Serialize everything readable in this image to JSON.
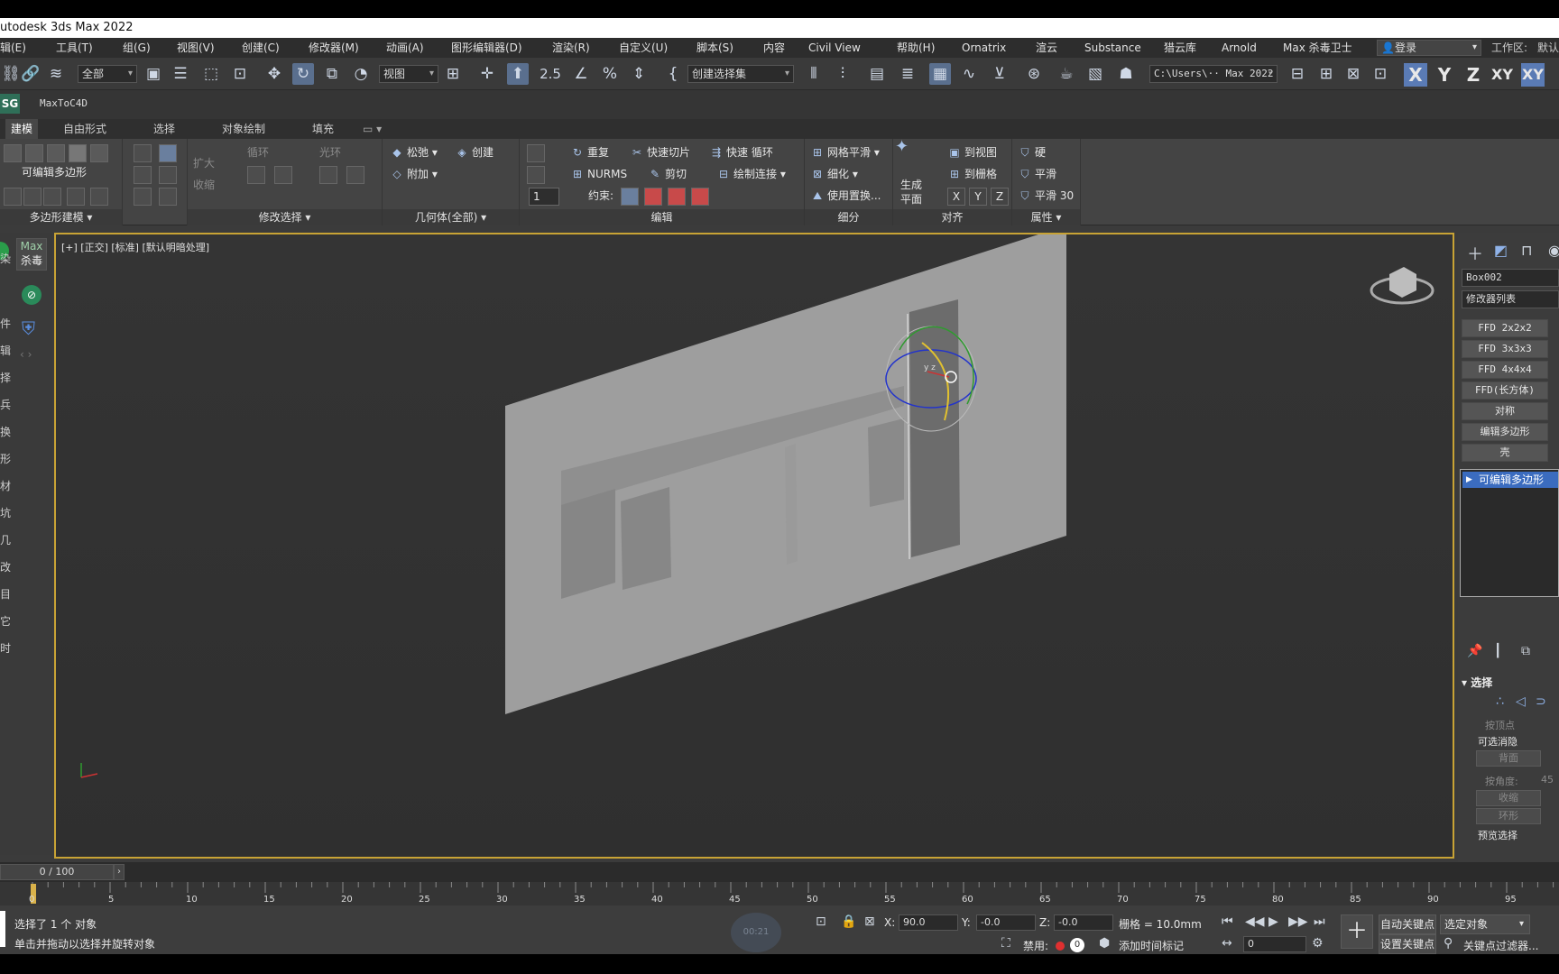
{
  "window": {
    "title": "utodesk 3ds Max 2022"
  },
  "menu": {
    "items": [
      "辑(E)",
      "工具(T)",
      "组(G)",
      "视图(V)",
      "创建(C)",
      "修改器(M)",
      "动画(A)",
      "图形编辑器(D)",
      "渲染(R)",
      "自定义(U)",
      "脚本(S)",
      "内容",
      "Civil View",
      "帮助(H)",
      "Ornatrix",
      "渲云",
      "Substance",
      "猎云库",
      "Arnold",
      "Max 杀毒卫士"
    ],
    "login": "登录",
    "workspace": "工作区:",
    "workspace_value": "默认"
  },
  "toolbar": {
    "filter_dropdown": "全部",
    "reference_dropdown": "视图",
    "snap_label": "2.5",
    "selection_set": "创建选择集",
    "path_dropdown": "C:\\Users\\·· Max 2022",
    "axis_x": "X",
    "axis_y": "Y",
    "axis_z": "Z",
    "axis_xy": "XY",
    "axis_xy2": "XY"
  },
  "subbar": {
    "badge": "SG",
    "plugin": "MaxToC4D"
  },
  "ribbon_tabs": [
    "建模",
    "自由形式",
    "选择",
    "对象绘制",
    "填充"
  ],
  "ribbon": {
    "poly_label": "可编辑多边形",
    "grow": "扩大",
    "shrink": "收缩",
    "loop": "循环",
    "ring": "光环",
    "relax": "松弛",
    "create": "创建",
    "attach": "附加",
    "repeat": "重复",
    "quickslice": "快速切片",
    "quickloop": "快速 循环",
    "nurms": "NURMS",
    "cut": "剪切",
    "paintconnect": "绘制连接",
    "constraint": "约束:",
    "spinner_value": "1",
    "meshsmooth": "网格平滑",
    "tessellate": "细化",
    "usedisplace": "使用置换...",
    "genplane_1": "生成",
    "genplane_2": "平面",
    "toview": "到视图",
    "togrid": "到栅格",
    "ax_x": "X",
    "ax_y": "Y",
    "ax_z": "Z",
    "hard": "硬",
    "smooth": "平滑",
    "smooth30": "平滑 30",
    "groups": [
      "多边形建模 ▾",
      "修改选择 ▾",
      "几何体(全部) ▾",
      "编辑",
      "细分",
      "对齐",
      "属性 ▾"
    ]
  },
  "left_plugin": {
    "max": "Max",
    "antivirus": "杀毒"
  },
  "left_chars": [
    "染",
    "件",
    "辑",
    "择",
    "兵",
    "换",
    "形",
    "材",
    "坑",
    "几",
    "改",
    "目",
    "它",
    "时"
  ],
  "viewport": {
    "label": "[+] [正交] [标准] [默认明暗处理]",
    "gizmo_axes": "y z"
  },
  "command_panel": {
    "object_name": "Box002",
    "modifier_list": "修改器列表",
    "modifiers": [
      "FFD 2x2x2",
      "FFD 3x3x3",
      "FFD 4x4x4",
      "FFD(长方体)",
      "对称",
      "编辑多边形",
      "壳"
    ],
    "stack_item": "可编辑多边形",
    "selection_rollout": "选择",
    "by_vertex": "按顶点",
    "ignore_backface_title": "可选消隐",
    "backface": "背面",
    "by_angle": "按角度:",
    "angle_value": "45",
    "shrink": "收缩",
    "ring": "环形",
    "preview_selection": "预览选择"
  },
  "timeline": {
    "frame": "0 / 100",
    "ticks": [
      "0",
      "5",
      "10",
      "15",
      "20",
      "25",
      "30",
      "35",
      "40",
      "45",
      "50",
      "55",
      "60",
      "65",
      "70",
      "75",
      "80",
      "85",
      "90",
      "95"
    ]
  },
  "status": {
    "selected": "选择了 1 个 对象",
    "hint": "单击并拖动以选择并旋转对象",
    "x_label": "X:",
    "x_value": "90.0",
    "y_label": "Y:",
    "y_value": "-0.0",
    "z_label": "Z:",
    "z_value": "-0.0",
    "grid": "栅格 = 10.0mm",
    "disabled": "禁用:",
    "add_time_tag": "添加时间标记",
    "auto_key": "自动关键点",
    "selected_obj": "选定对象",
    "set_key": "设置关键点",
    "key_filters": "关键点过滤器...",
    "frame_spinner": "0",
    "watermark": "00:21"
  },
  "colors": {
    "accent": "#c8a335",
    "selection": "#3b6cbf",
    "active_axis": "#5a7bb5"
  }
}
